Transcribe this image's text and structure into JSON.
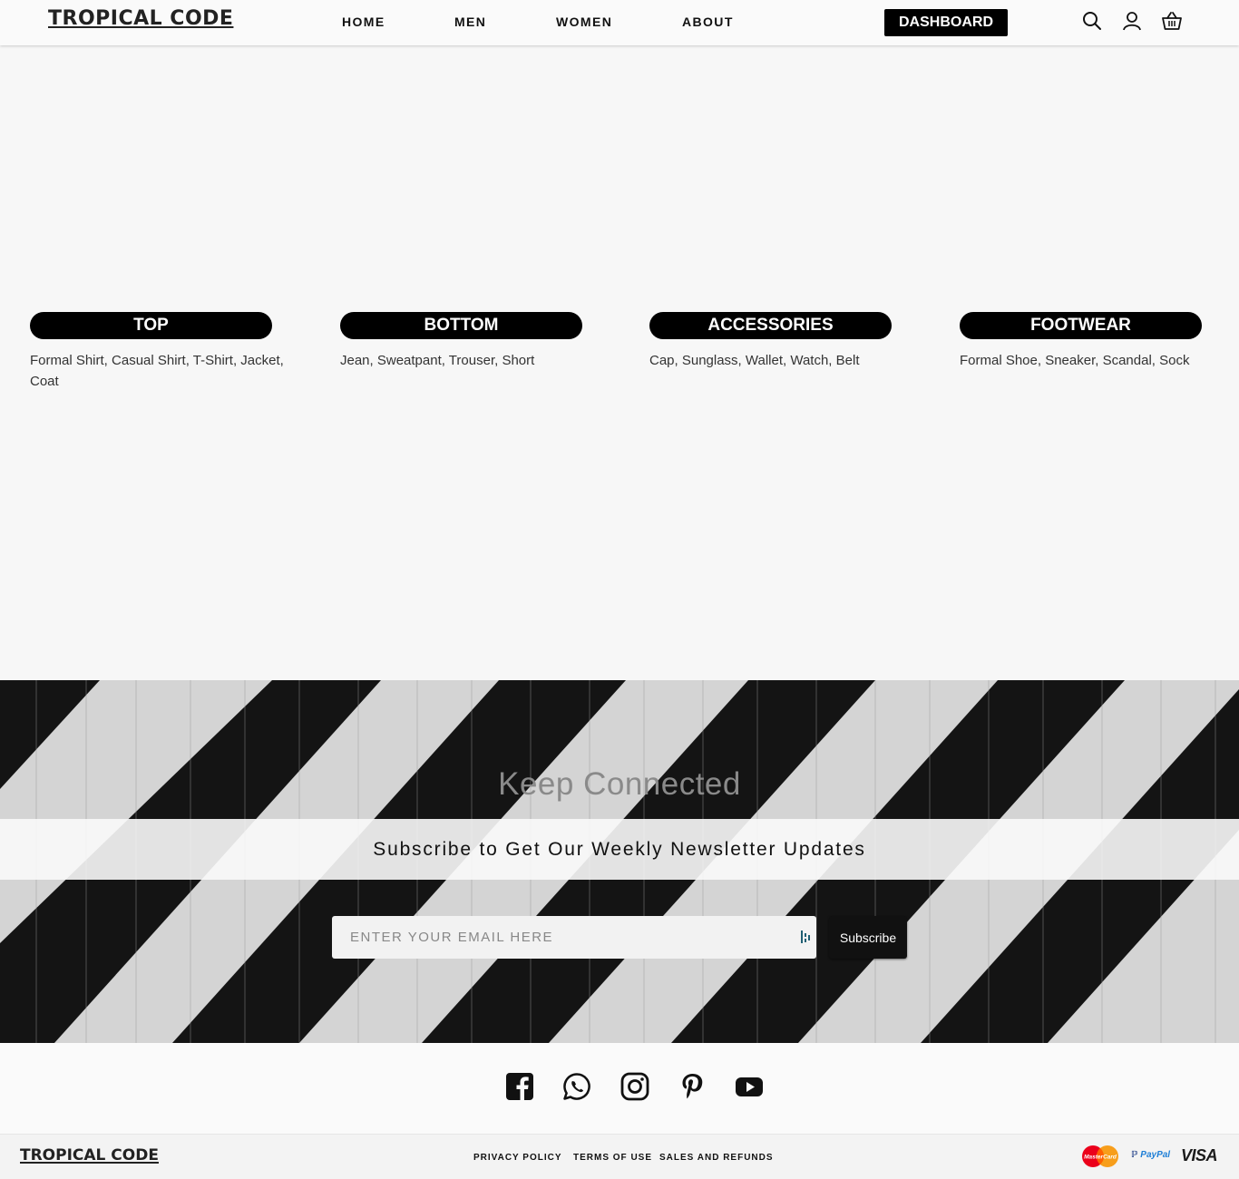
{
  "header": {
    "logo": "TROPICAL CODE",
    "nav": [
      "HOME",
      "MEN",
      "WOMEN",
      "ABOUT"
    ],
    "dashboard_label": "DASHBOARD",
    "icons": [
      "search-icon",
      "user-icon",
      "basket-icon"
    ]
  },
  "categories": [
    {
      "title": "TOP",
      "items": "Formal Shirt, Casual Shirt, T-Shirt, Jacket, Coat"
    },
    {
      "title": "BOTTOM",
      "items": "Jean, Sweatpant, Trouser, Short"
    },
    {
      "title": "ACCESSORIES",
      "items": "Cap, Sunglass, Wallet, Watch, Belt"
    },
    {
      "title": "FOOTWEAR",
      "items": "Formal Shoe, Sneaker, Scandal, Sock"
    }
  ],
  "newsletter": {
    "heading": "Keep Connected",
    "subheading": "Subscribe to Get Our Weekly Newsletter Updates",
    "email_placeholder": "ENTER YOUR EMAIL HERE",
    "subscribe_label": "Subscribe"
  },
  "social": [
    "facebook-icon",
    "whatsapp-icon",
    "instagram-icon",
    "pinterest-icon",
    "youtube-icon"
  ],
  "footer": {
    "logo": "TROPICAL CODE",
    "links": [
      "PRIVACY POLICY",
      "TERMS OF USE",
      "SALES AND REFUNDS"
    ],
    "payments": {
      "mastercard": "MasterCard",
      "paypal": "PayPal",
      "visa": "VISA"
    }
  },
  "colors": {
    "accent": "#000000",
    "page_bg": "#f7f7f7"
  }
}
